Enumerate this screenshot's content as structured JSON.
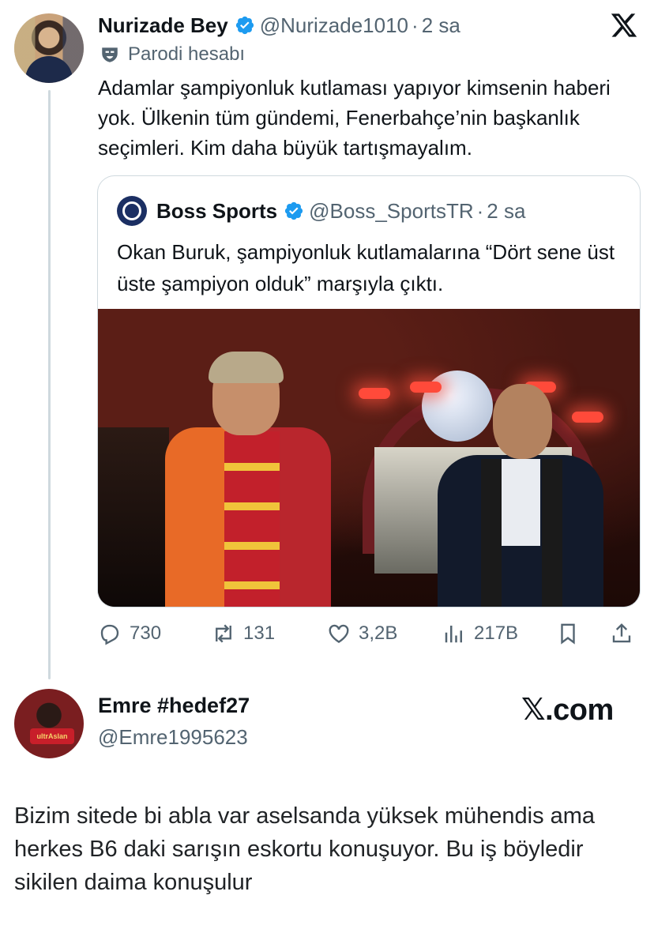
{
  "tweet": {
    "author_name": "Nurizade Bey",
    "handle": "@Nurizade1010",
    "separator": "·",
    "time": "2 sa",
    "parody_label": "Parodi hesabı",
    "text": "Adamlar şampiyonluk kutlaması yapıyor kimsenin haberi yok. Ülkenin tüm gündemi, Fenerbahçe’nin başkanlık seçimleri. Kim daha büyük tartışmayalım.",
    "quote": {
      "author_name": "Boss Sports",
      "handle": "@Boss_SportsTR",
      "separator": "·",
      "time": "2 sa",
      "text": "Okan Buruk, şampiyonluk kutlamalarına “Dört sene üst üste şampiyon olduk” marşıyla çıktı."
    },
    "actions": {
      "replies": "730",
      "reposts": "131",
      "likes": "3,2B",
      "views": "217B"
    },
    "icons": [
      "verified-icon",
      "x-logo-icon",
      "parody-mask-icon",
      "reply-icon",
      "repost-icon",
      "like-icon",
      "views-icon",
      "bookmark-icon",
      "share-icon"
    ],
    "colors": {
      "verified": "#1d9bf0",
      "muted": "#536471",
      "border": "#cfd9de"
    }
  },
  "reply": {
    "author_name": "Emre #hedef27",
    "handle": "@Emre1995623",
    "watermark": "𝕏.com",
    "text": "Bizim sitede bi abla var aselsanda yüksek mühendis ama herkes  B6 daki sarışın eskortu konuşuyor. Bu iş böyledir sikilen daima konuşulur"
  }
}
